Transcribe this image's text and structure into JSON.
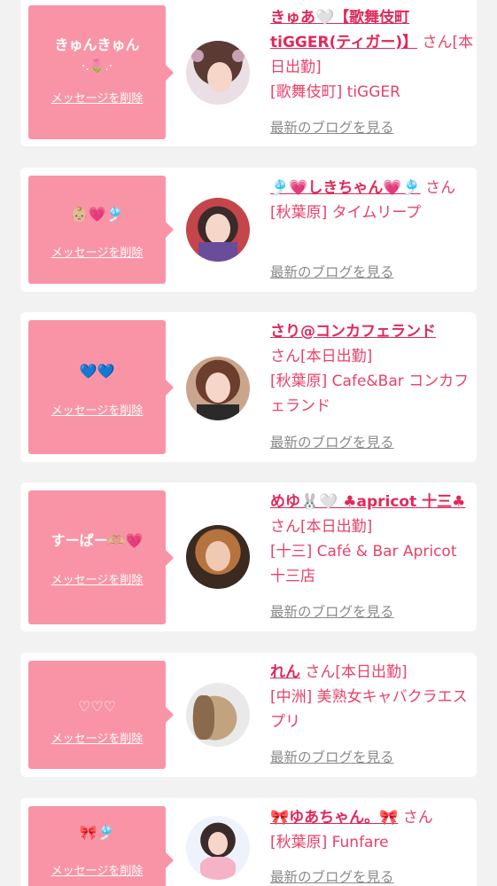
{
  "delete_label": "メッセージを削除",
  "blog_label": "最新のブログを見る",
  "colors": {
    "background": "#f2f2f2",
    "bubble": "#f994a6",
    "name": "#e0295a",
    "text": "#e8416a",
    "link": "#8a8a8a"
  },
  "messages": [
    {
      "bubble_line1": "きゅんきゅん",
      "bubble_line2": "·.🌷.·",
      "name": "きゅあ🤍【歌舞伎町tiGGER(ティガー)】",
      "suffix": "さん",
      "status": "[本日出勤]",
      "store": "[歌舞伎町] tiGGER"
    },
    {
      "bubble_line1": "👶🏼💗🎐",
      "name": "🎐💗しきちゃん💗🎐",
      "suffix": "さん",
      "status": "",
      "store": "[秋葉原] タイムリープ"
    },
    {
      "bubble_line1": "💙💙",
      "name": "さり@コンカフェランド",
      "suffix": "さん",
      "status": "[本日出勤]",
      "store": "[秋葉原] Cafe&Bar コンカフェランド"
    },
    {
      "bubble_line1": "すーぱー🫶🏼💗",
      "name": "めゆ🐰🤍 ♣apricot 十三♣",
      "suffix": "さん",
      "status": "[本日出勤]",
      "store": "[十三] Café & Bar Apricot 十三店"
    },
    {
      "bubble_line1": "♡♡♡",
      "name": "れん",
      "suffix": "さん",
      "status": "[本日出勤]",
      "store": "[中洲] 美熟女キャバクラエスプリ"
    },
    {
      "bubble_line1": "🎀🎐",
      "name": "🎀ゆあちゃん。🎀",
      "suffix": "さん",
      "status": "",
      "store": "[秋葉原] Funfare"
    }
  ]
}
